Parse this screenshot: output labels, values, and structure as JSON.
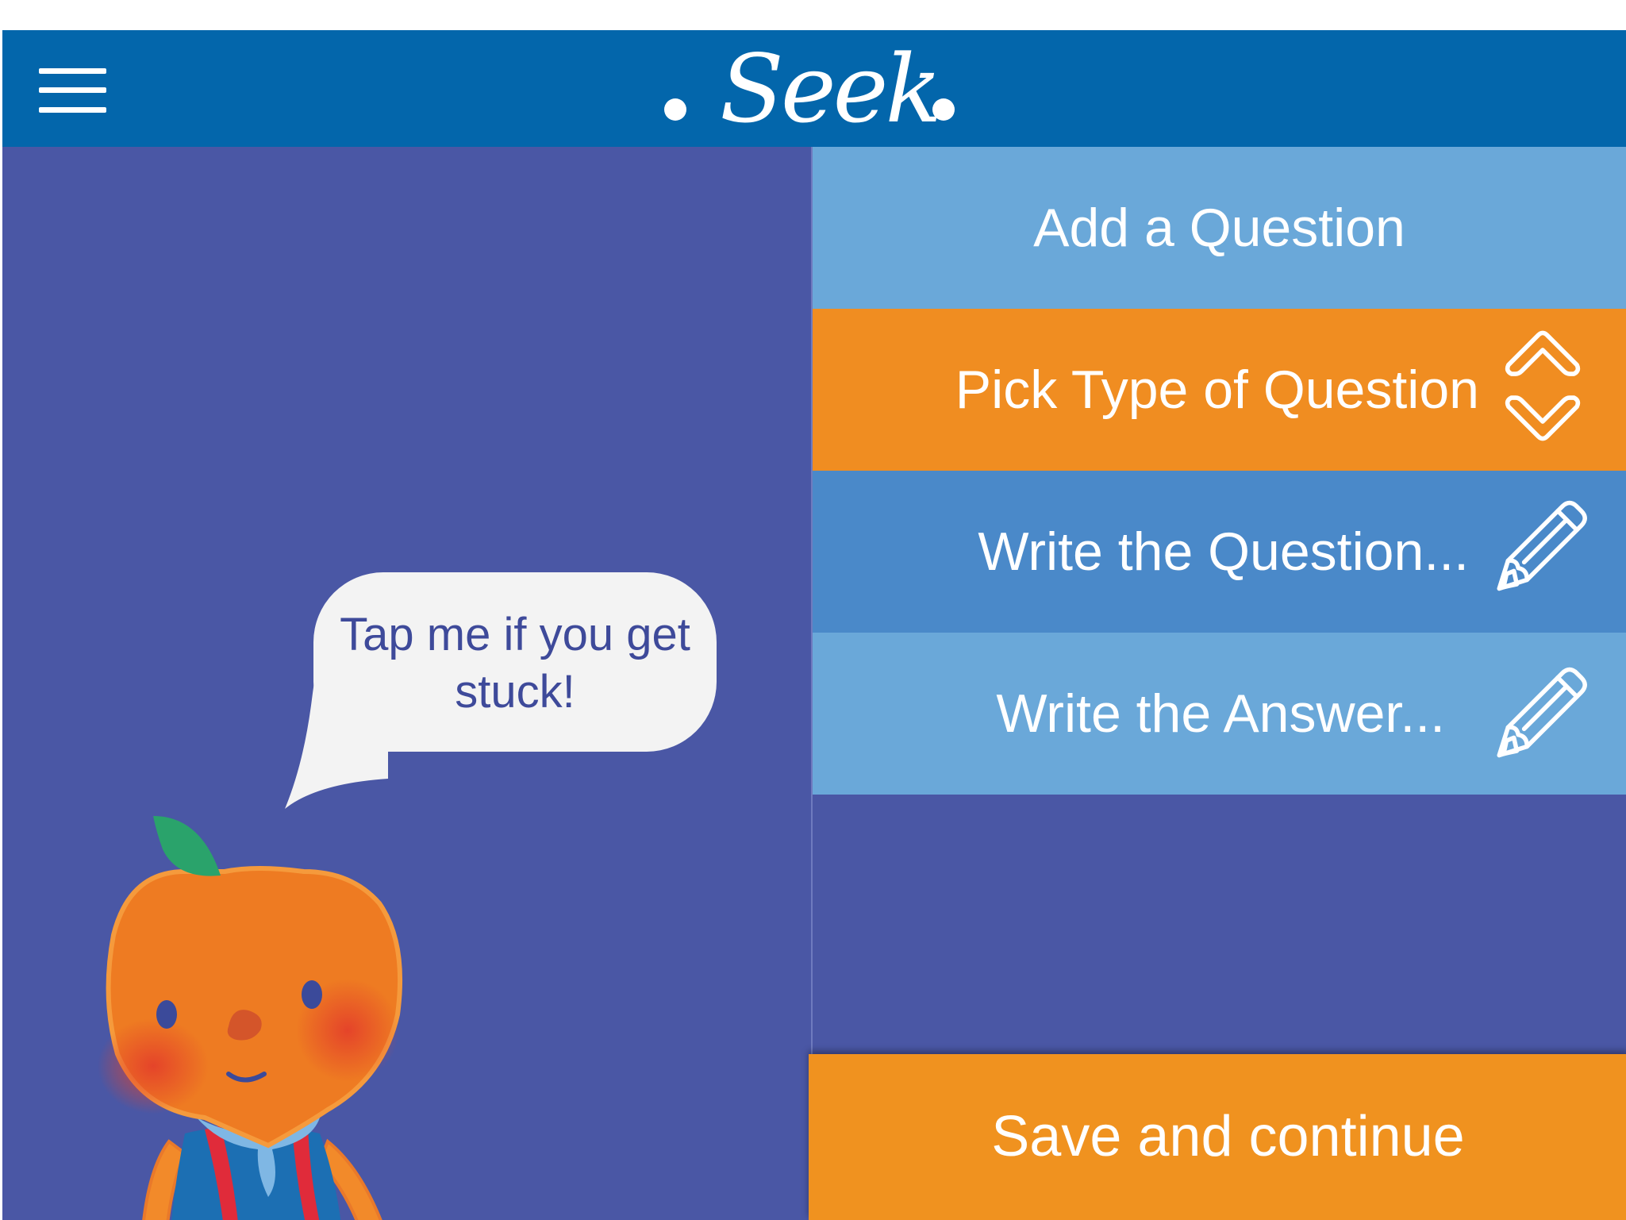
{
  "header": {
    "app_name": "Seek",
    "menu_icon": "hamburger-menu-icon"
  },
  "steps": [
    {
      "label": "Add a Question",
      "icon": null,
      "color": "#6aa8d9"
    },
    {
      "label": "Pick Type of Question",
      "icon": "chevron-up-down-icon",
      "color": "#f08d21"
    },
    {
      "label": "Write the Question...",
      "icon": "pencil-icon",
      "color": "#4a89c9"
    },
    {
      "label": "Write the Answer...",
      "icon": "pencil-icon",
      "color": "#6aa8d9"
    }
  ],
  "helper": {
    "speech_text": "Tap me if you get stuck!",
    "mascot": "orange-mascot"
  },
  "footer": {
    "save_label": "Save and continue"
  },
  "colors": {
    "header": "#0366ab",
    "background": "#4a57a5",
    "accent_orange": "#f0921f",
    "speech_text": "#3e4a9a"
  }
}
